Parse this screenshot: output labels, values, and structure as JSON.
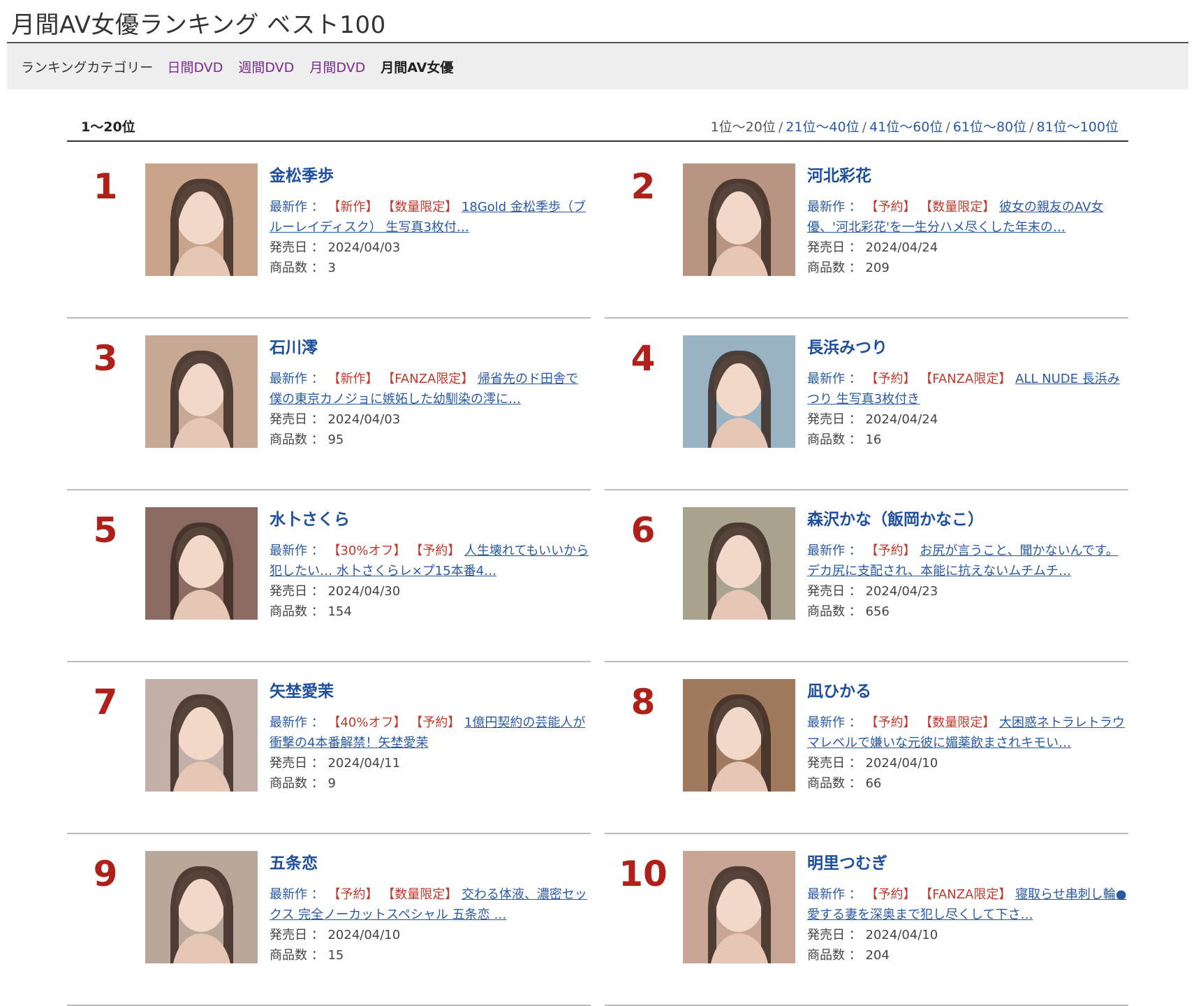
{
  "page": {
    "title": "月間AV女優ランキング ベスト100"
  },
  "category": {
    "label": "ランキングカテゴリー",
    "links": [
      "日間DVD",
      "週間DVD",
      "月間DVD"
    ],
    "current": "月間AV女優"
  },
  "range": {
    "current": "1～20位",
    "pages": [
      "1位～20位",
      "21位～40位",
      "41位～60位",
      "61位～80位",
      "81位～100位"
    ]
  },
  "labels": {
    "latest": "最新作",
    "release": "発売日",
    "count": "商品数",
    "colon": "："
  },
  "items": [
    {
      "rank": "1",
      "name": "金松季歩",
      "tags": [
        "【新作】",
        "【数量限定】"
      ],
      "work": "18Gold 金松季歩（ブルーレイディスク） 生写真3枚付…",
      "date": "2024/04/03",
      "count": "3",
      "photo_color": "#c9a48a"
    },
    {
      "rank": "2",
      "name": "河北彩花",
      "tags": [
        "【予約】",
        "【数量限定】"
      ],
      "work": "彼女の親友のAV女優、'河北彩花'を一生分ハメ尽くした年末の…",
      "date": "2024/04/24",
      "count": "209",
      "photo_color": "#b89583"
    },
    {
      "rank": "3",
      "name": "石川澪",
      "tags": [
        "【新作】",
        "【FANZA限定】"
      ],
      "work": "帰省先のド田舎で僕の東京カノジョに嫉妬した幼馴染の澪に…",
      "date": "2024/04/03",
      "count": "95",
      "photo_color": "#c7a894"
    },
    {
      "rank": "4",
      "name": "長浜みつり",
      "tags": [
        "【予約】",
        "【FANZA限定】"
      ],
      "work": "ALL NUDE 長浜みつり 生写真3枚付き",
      "date": "2024/04/24",
      "count": "16",
      "photo_color": "#9ab3c4"
    },
    {
      "rank": "5",
      "name": "水卜さくら",
      "tags": [
        "【30%オフ】",
        "【予約】"
      ],
      "work": "人生壊れてもいいから犯したい… 水卜さくらレ×プ15本番4…",
      "date": "2024/04/30",
      "count": "154",
      "photo_color": "#8a6a62"
    },
    {
      "rank": "6",
      "name": "森沢かな（飯岡かなこ）",
      "tags": [
        "【予約】"
      ],
      "work": "お尻が言うこと、聞かないんです。デカ尻に支配され、本能に抗えないムチムチ…",
      "date": "2024/04/23",
      "count": "656",
      "photo_color": "#a8a28f"
    },
    {
      "rank": "7",
      "name": "矢埜愛茉",
      "tags": [
        "【40%オフ】",
        "【予約】"
      ],
      "work": "1億円契約の芸能人が衝撃の4本番解禁！矢埜愛茉",
      "date": "2024/04/11",
      "count": "9",
      "photo_color": "#c2b0a8"
    },
    {
      "rank": "8",
      "name": "凪ひかる",
      "tags": [
        "【予約】",
        "【数量限定】"
      ],
      "work": "大困惑ネトラレトラウマレベルで嫌いな元彼に媚薬飲まされキモい…",
      "date": "2024/04/10",
      "count": "66",
      "photo_color": "#a07a5e"
    },
    {
      "rank": "9",
      "name": "五条恋",
      "tags": [
        "【予約】",
        "【数量限定】"
      ],
      "work": "交わる体液、濃密セックス 完全ノーカットスペシャル 五条恋 …",
      "date": "2024/04/10",
      "count": "15",
      "photo_color": "#b9a79b"
    },
    {
      "rank": "10",
      "name": "明里つむぎ",
      "tags": [
        "【予約】",
        "【FANZA限定】"
      ],
      "work": "寝取らせ串刺し輪● 愛する妻を深奥まで犯し尽くして下さ…",
      "date": "2024/04/10",
      "count": "204",
      "photo_color": "#c9a595"
    }
  ]
}
